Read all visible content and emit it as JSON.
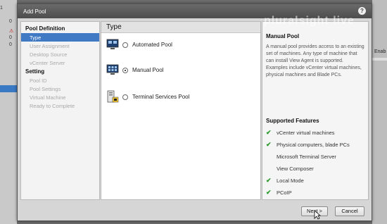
{
  "background": {
    "left_rows": [
      "1",
      "0",
      "0",
      "0",
      "0"
    ],
    "right_label": "Enab"
  },
  "dialog": {
    "title": "Add Pool",
    "help_label": "?",
    "watermark": "pluralsight live"
  },
  "nav": {
    "sections": [
      {
        "heading": "Pool Definition",
        "items": [
          {
            "label": "Type",
            "active": true
          },
          {
            "label": "User Assignment",
            "active": false
          },
          {
            "label": "Desktop Source",
            "active": false
          },
          {
            "label": "vCenter Server",
            "active": false
          }
        ]
      },
      {
        "heading": "Setting",
        "items": [
          {
            "label": "Pool ID",
            "active": false
          },
          {
            "label": "Pool Settings",
            "active": false
          },
          {
            "label": "Virtual Machine",
            "active": false
          },
          {
            "label": "Ready to Complete",
            "active": false
          }
        ]
      }
    ]
  },
  "content": {
    "heading": "Type",
    "options": [
      {
        "label": "Automated Pool",
        "selected": false,
        "icon": "automated-pool-icon"
      },
      {
        "label": "Manual Pool",
        "selected": true,
        "icon": "manual-pool-icon"
      },
      {
        "label": "Terminal Services Pool",
        "selected": false,
        "icon": "terminal-services-icon"
      }
    ]
  },
  "info": {
    "title": "Manual Pool",
    "description": "A manual pool provides access to an existing set of machines. Any type of machine that can install View Agent is supported. Examples include vCenter virtual machines, physical machines and Blade PCs.",
    "features_heading": "Supported Features",
    "features": [
      {
        "label": "vCenter virtual machines",
        "supported": true
      },
      {
        "label": "Physical computers, blade PCs",
        "supported": true
      },
      {
        "label": "Microsoft Terminal Server",
        "supported": false
      },
      {
        "label": "View Composer",
        "supported": false
      },
      {
        "label": "Local Mode",
        "supported": true
      },
      {
        "label": "PCoIP",
        "supported": true
      }
    ],
    "check_symbol": "✔"
  },
  "buttons": {
    "next": "Next >",
    "cancel": "Cancel"
  },
  "colors": {
    "accent": "#4079c4",
    "check": "#2c9a2c",
    "titlebar": "#555555"
  }
}
